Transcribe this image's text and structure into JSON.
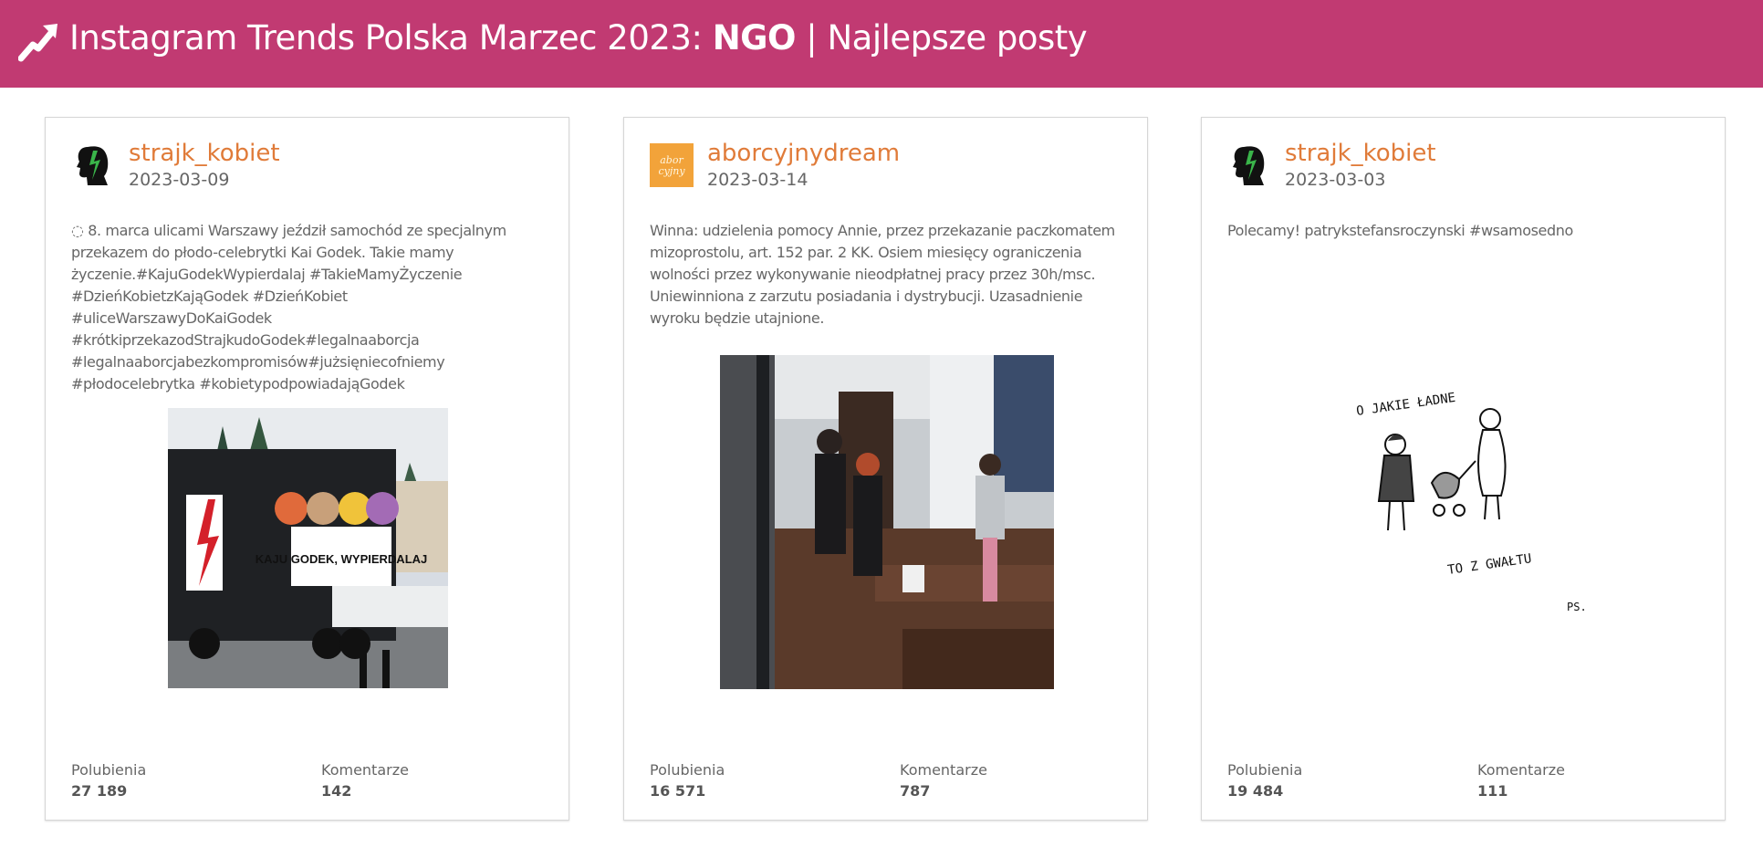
{
  "header": {
    "title_prefix": "Instagram Trends Polska Marzec 2023: ",
    "title_bold": "NGO",
    "title_suffix": " | Najlepsze posty",
    "icon": "trending-up-icon",
    "bg_color": "#c13a72"
  },
  "labels": {
    "likes": "Polubienia",
    "comments": "Komentarze"
  },
  "posts": [
    {
      "username": "strajk_kobiet",
      "date": "2023-03-09",
      "caption": "◌ 8. marca ulicami Warszawy jeździł samochód ze specjalnym przekazem do płodo-celebrytki Kai Godek. Takie mamy życzenie.#KajuGodekWypierdalaj #TakieMamyŻyczenie #DzieńKobietzKająGodek #DzieńKobiet #uliceWarszawyDoKaiGodek #krótkiprzekazodStrajkudoGodek#legalnaaborcja #legalnaaborcjabezkompromisów#jużsięniecofniemy #płodocelebrytka #kobietypodpowiadająGodek",
      "image_text": "KAJU GODEK, WYPIERDALAJ",
      "likes": "27 189",
      "comments": "142"
    },
    {
      "username": "aborcyjnydream",
      "date": "2023-03-14",
      "avatar_text": "abor cyjny",
      "caption": "Winna: udzielenia pomocy Annie, przez przekazanie paczkomatem mizoprostolu, art. 152 par. 2 KK. Osiem miesięcy ograniczenia wolności przez wykonywanie nieodpłatnej pracy przez 30h/msc. Uniewinniona z zarzutu posiadania i dystrybucji. Uzasadnienie wyroku będzie utajnione.",
      "likes": "16 571",
      "comments": "787"
    },
    {
      "username": "strajk_kobiet",
      "date": "2023-03-03",
      "caption": "Polecamy! patrykstefansroczynski #wsamosedno",
      "image_text_top": "O JAKIE ŁADNE",
      "image_text_bottom": "TO Z GWAŁTU",
      "image_signature": "PS.",
      "likes": "19 484",
      "comments": "111"
    }
  ]
}
